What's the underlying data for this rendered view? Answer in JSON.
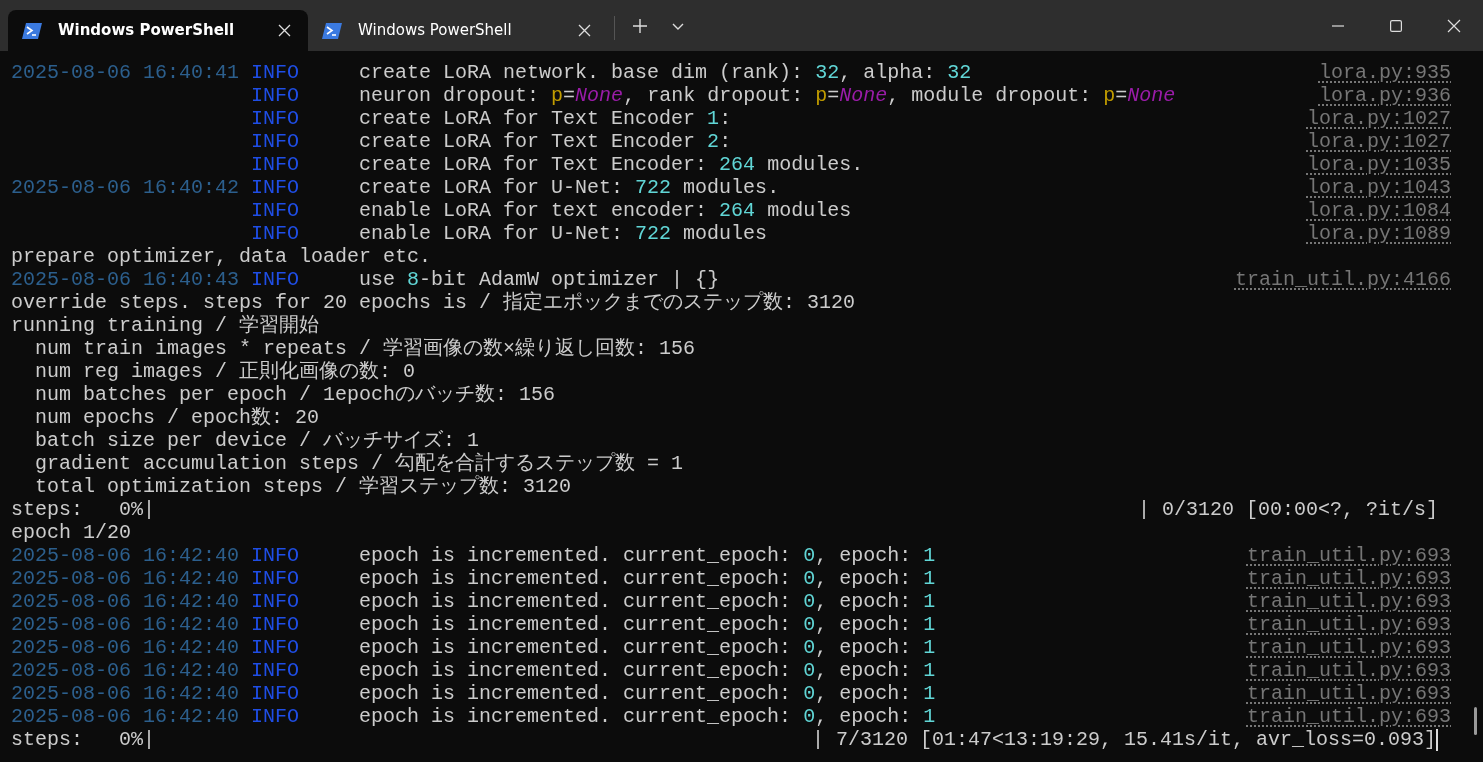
{
  "tabs": [
    {
      "title": "Windows PowerShell",
      "selected": true
    },
    {
      "title": "Windows PowerShell",
      "selected": false
    }
  ],
  "terminal": {
    "lines": [
      {
        "kind": "log",
        "time": "2025-08-06 16:40:41",
        "level": "INFO",
        "message": [
          {
            "kind": "text",
            "t": "create LoRA network. base dim (rank): "
          },
          {
            "kind": "number",
            "t": "32"
          },
          {
            "kind": "text",
            "t": ", alpha: "
          },
          {
            "kind": "number",
            "t": "32"
          }
        ],
        "source": "lora.py:935"
      },
      {
        "kind": "log",
        "level": "INFO",
        "message": [
          {
            "kind": "text",
            "t": "neuron dropout: "
          },
          {
            "kind": "key",
            "t": "p"
          },
          {
            "kind": "text",
            "t": "="
          },
          {
            "kind": "none",
            "t": "None"
          },
          {
            "kind": "text",
            "t": ", rank dropout: "
          },
          {
            "kind": "key",
            "t": "p"
          },
          {
            "kind": "text",
            "t": "="
          },
          {
            "kind": "none",
            "t": "None"
          },
          {
            "kind": "text",
            "t": ", module dropout: "
          },
          {
            "kind": "key",
            "t": "p"
          },
          {
            "kind": "text",
            "t": "="
          },
          {
            "kind": "none",
            "t": "None"
          }
        ],
        "source": "lora.py:936"
      },
      {
        "kind": "log",
        "level": "INFO",
        "message": [
          {
            "kind": "text",
            "t": "create LoRA for Text Encoder "
          },
          {
            "kind": "number",
            "t": "1"
          },
          {
            "kind": "text",
            "t": ":"
          }
        ],
        "source": "lora.py:1027"
      },
      {
        "kind": "log",
        "level": "INFO",
        "message": [
          {
            "kind": "text",
            "t": "create LoRA for Text Encoder "
          },
          {
            "kind": "number",
            "t": "2"
          },
          {
            "kind": "text",
            "t": ":"
          }
        ],
        "source": "lora.py:1027"
      },
      {
        "kind": "log",
        "level": "INFO",
        "message": [
          {
            "kind": "text",
            "t": "create LoRA for Text Encoder: "
          },
          {
            "kind": "number",
            "t": "264"
          },
          {
            "kind": "text",
            "t": " modules."
          }
        ],
        "source": "lora.py:1035"
      },
      {
        "kind": "log",
        "time": "2025-08-06 16:40:42",
        "level": "INFO",
        "message": [
          {
            "kind": "text",
            "t": "create LoRA for U-Net: "
          },
          {
            "kind": "number",
            "t": "722"
          },
          {
            "kind": "text",
            "t": " modules."
          }
        ],
        "source": "lora.py:1043"
      },
      {
        "kind": "log",
        "level": "INFO",
        "message": [
          {
            "kind": "text",
            "t": "enable LoRA for text encoder: "
          },
          {
            "kind": "number",
            "t": "264"
          },
          {
            "kind": "text",
            "t": " modules"
          }
        ],
        "source": "lora.py:1084"
      },
      {
        "kind": "log",
        "level": "INFO",
        "message": [
          {
            "kind": "text",
            "t": "enable LoRA for U-Net: "
          },
          {
            "kind": "number",
            "t": "722"
          },
          {
            "kind": "text",
            "t": " modules"
          }
        ],
        "source": "lora.py:1089"
      },
      {
        "kind": "plain",
        "text": "prepare optimizer, data loader etc."
      },
      {
        "kind": "log",
        "time": "2025-08-06 16:40:43",
        "level": "INFO",
        "message": [
          {
            "kind": "text",
            "t": "use "
          },
          {
            "kind": "number",
            "t": "8"
          },
          {
            "kind": "text",
            "t": "-bit AdamW optimizer | {}"
          }
        ],
        "source": "train_util.py:4166"
      },
      {
        "kind": "plain",
        "text": "override steps. steps for 20 epochs is / 指定エポックまでのステップ数: 3120"
      },
      {
        "kind": "plain",
        "text": "running training / 学習開始"
      },
      {
        "kind": "plain",
        "text": "  num train images * repeats / 学習画像の数×繰り返し回数: 156"
      },
      {
        "kind": "plain",
        "text": "  num reg images / 正則化画像の数: 0"
      },
      {
        "kind": "plain",
        "text": "  num batches per epoch / 1epochのバッチ数: 156"
      },
      {
        "kind": "plain",
        "text": "  num epochs / epoch数: 20"
      },
      {
        "kind": "plain",
        "text": "  batch size per device / バッチサイズ: 1"
      },
      {
        "kind": "plain",
        "text": "  gradient accumulation steps / 勾配を合計するステップ数 = 1"
      },
      {
        "kind": "plain",
        "text": "  total optimization steps / 学習ステップ数: 3120"
      },
      {
        "kind": "progress",
        "left": "steps:   0%|",
        "right": "| 0/3120 [00:00<?, ?it/s]",
        "cursor": false
      },
      {
        "kind": "plain",
        "text": "epoch 1/20"
      },
      {
        "kind": "log",
        "time": "2025-08-06 16:42:40",
        "level": "INFO",
        "message": [
          {
            "kind": "text",
            "t": "epoch is incremented. current_epoch: "
          },
          {
            "kind": "number",
            "t": "0"
          },
          {
            "kind": "text",
            "t": ", epoch: "
          },
          {
            "kind": "number",
            "t": "1"
          }
        ],
        "source": "train_util.py:693"
      },
      {
        "kind": "log",
        "time": "2025-08-06 16:42:40",
        "level": "INFO",
        "message": [
          {
            "kind": "text",
            "t": "epoch is incremented. current_epoch: "
          },
          {
            "kind": "number",
            "t": "0"
          },
          {
            "kind": "text",
            "t": ", epoch: "
          },
          {
            "kind": "number",
            "t": "1"
          }
        ],
        "source": "train_util.py:693"
      },
      {
        "kind": "log",
        "time": "2025-08-06 16:42:40",
        "level": "INFO",
        "message": [
          {
            "kind": "text",
            "t": "epoch is incremented. current_epoch: "
          },
          {
            "kind": "number",
            "t": "0"
          },
          {
            "kind": "text",
            "t": ", epoch: "
          },
          {
            "kind": "number",
            "t": "1"
          }
        ],
        "source": "train_util.py:693"
      },
      {
        "kind": "log",
        "time": "2025-08-06 16:42:40",
        "level": "INFO",
        "message": [
          {
            "kind": "text",
            "t": "epoch is incremented. current_epoch: "
          },
          {
            "kind": "number",
            "t": "0"
          },
          {
            "kind": "text",
            "t": ", epoch: "
          },
          {
            "kind": "number",
            "t": "1"
          }
        ],
        "source": "train_util.py:693"
      },
      {
        "kind": "log",
        "time": "2025-08-06 16:42:40",
        "level": "INFO",
        "message": [
          {
            "kind": "text",
            "t": "epoch is incremented. current_epoch: "
          },
          {
            "kind": "number",
            "t": "0"
          },
          {
            "kind": "text",
            "t": ", epoch: "
          },
          {
            "kind": "number",
            "t": "1"
          }
        ],
        "source": "train_util.py:693"
      },
      {
        "kind": "log",
        "time": "2025-08-06 16:42:40",
        "level": "INFO",
        "message": [
          {
            "kind": "text",
            "t": "epoch is incremented. current_epoch: "
          },
          {
            "kind": "number",
            "t": "0"
          },
          {
            "kind": "text",
            "t": ", epoch: "
          },
          {
            "kind": "number",
            "t": "1"
          }
        ],
        "source": "train_util.py:693"
      },
      {
        "kind": "log",
        "time": "2025-08-06 16:42:40",
        "level": "INFO",
        "message": [
          {
            "kind": "text",
            "t": "epoch is incremented. current_epoch: "
          },
          {
            "kind": "number",
            "t": "0"
          },
          {
            "kind": "text",
            "t": ", epoch: "
          },
          {
            "kind": "number",
            "t": "1"
          }
        ],
        "source": "train_util.py:693"
      },
      {
        "kind": "log",
        "time": "2025-08-06 16:42:40",
        "level": "INFO",
        "message": [
          {
            "kind": "text",
            "t": "epoch is incremented. current_epoch: "
          },
          {
            "kind": "number",
            "t": "0"
          },
          {
            "kind": "text",
            "t": ", epoch: "
          },
          {
            "kind": "number",
            "t": "1"
          }
        ],
        "source": "train_util.py:693"
      },
      {
        "kind": "progress",
        "left": "steps:   0%|",
        "right": "| 7/3120 [01:47<13:19:29, 15.41s/it, avr_loss=0.093]",
        "cursor": true
      }
    ]
  }
}
